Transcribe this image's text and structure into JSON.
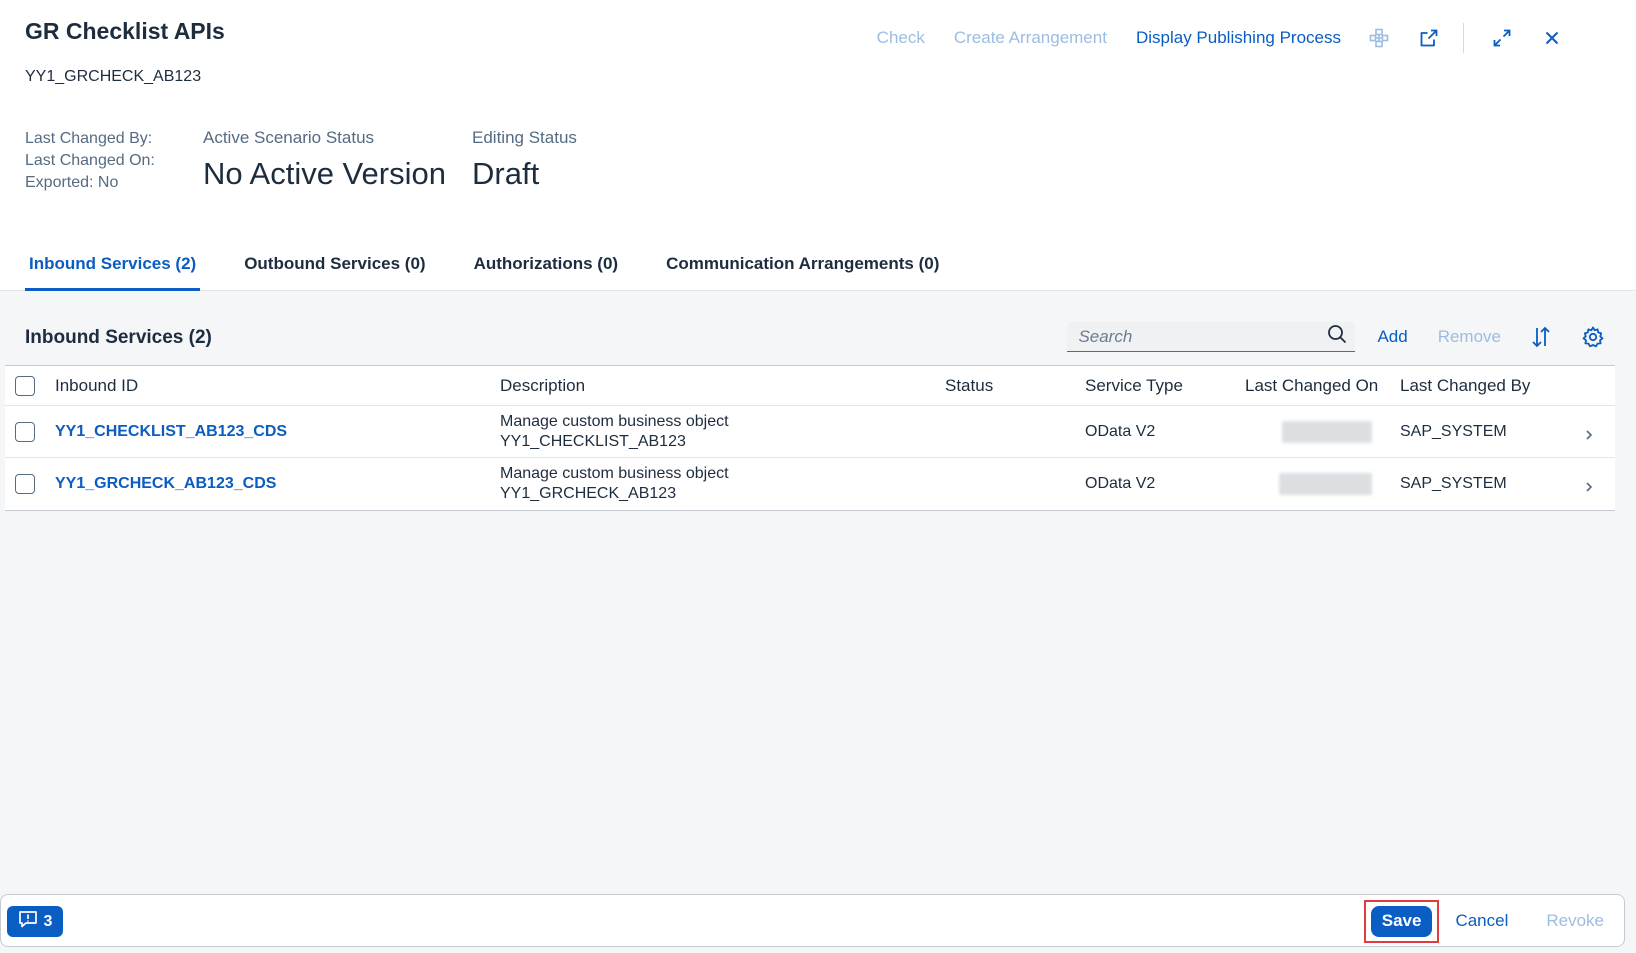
{
  "header": {
    "title": "GR Checklist APIs",
    "subtitle": "YY1_GRCHECK_AB123",
    "actions": {
      "check": "Check",
      "create_arrangement": "Create Arrangement",
      "display_publishing": "Display Publishing Process"
    },
    "meta": {
      "last_changed_by": "Last Changed By:",
      "last_changed_on": "Last Changed On:",
      "exported": "Exported: No"
    },
    "active_status": {
      "label": "Active Scenario Status",
      "value": "No Active Version"
    },
    "editing_status": {
      "label": "Editing Status",
      "value": "Draft"
    }
  },
  "tabs": [
    {
      "label": "Inbound Services (2)"
    },
    {
      "label": "Outbound Services (0)"
    },
    {
      "label": "Authorizations (0)"
    },
    {
      "label": "Communication Arrangements (0)"
    }
  ],
  "panel": {
    "title": "Inbound Services (2)",
    "search_placeholder": "Search",
    "add": "Add",
    "remove": "Remove"
  },
  "table": {
    "columns": {
      "id": "Inbound ID",
      "description": "Description",
      "status": "Status",
      "service_type": "Service Type",
      "changed_on": "Last Changed On",
      "changed_by": "Last Changed By"
    },
    "rows": [
      {
        "id": "YY1_CHECKLIST_AB123_CDS",
        "desc1": "Manage custom business object",
        "desc2": "YY1_CHECKLIST_AB123",
        "status": "",
        "service_type": "OData V2",
        "changed_by": "SAP_SYSTEM"
      },
      {
        "id": "YY1_GRCHECK_AB123_CDS",
        "desc1": "Manage custom business object",
        "desc2": "YY1_GRCHECK_AB123",
        "status": "",
        "service_type": "OData V2",
        "changed_by": "SAP_SYSTEM"
      }
    ]
  },
  "footer": {
    "message_count": "3",
    "save": "Save",
    "cancel": "Cancel",
    "revoke": "Revoke"
  },
  "colors": {
    "accent": "#0a5dc2",
    "disabled": "#9cbde0",
    "highlight": "#e03c3c"
  },
  "icons": [
    "structure-icon",
    "share-icon",
    "fullscreen-icon",
    "close-icon",
    "search-icon",
    "sort-icon",
    "settings-icon",
    "chevron-right-icon",
    "message-icon"
  ]
}
